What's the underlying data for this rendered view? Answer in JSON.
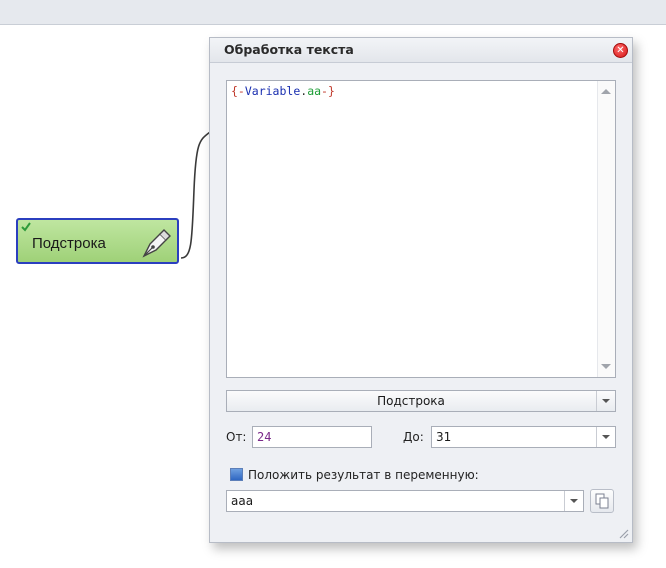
{
  "node": {
    "label": "Подстрока"
  },
  "dialog": {
    "title": "Обработка текста",
    "editor": {
      "open": "{-",
      "var": "Variable",
      "dot": ".",
      "name": "aa",
      "close": "-}"
    },
    "operation": {
      "selected": "Подстрока"
    },
    "from_label": "От:",
    "from_value": "24",
    "to_label": "До:",
    "to_value": "31",
    "store_result_label": "Положить результат в переменную:",
    "store_result_checked": true,
    "result_variable": "aaa"
  },
  "icons": {
    "node_status": "checkmark-icon",
    "node_type": "pen-icon",
    "close": "close-icon",
    "copy": "copy-icon",
    "resize": "resize-grip-icon"
  },
  "colors": {
    "node_fill": "#9fd178",
    "node_border": "#2b3fbf",
    "close_button": "#d41414",
    "token_brace": "#c0392b",
    "token_variable": "#1a2fb0",
    "token_name": "#1e9e37",
    "number": "#7a2a8a"
  }
}
